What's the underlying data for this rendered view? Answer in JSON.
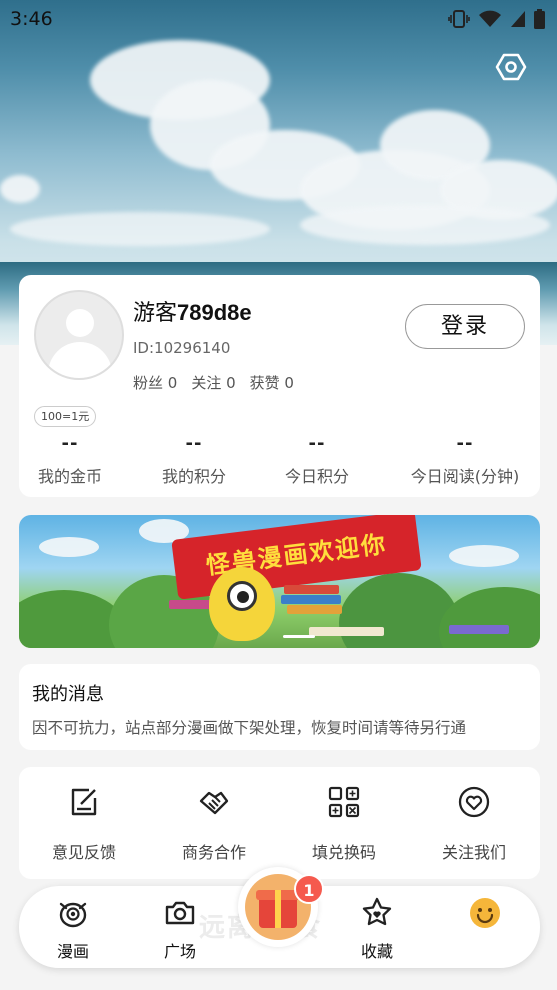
{
  "status_bar": {
    "time": "3:46"
  },
  "profile": {
    "username_prefix": "游客",
    "username_suffix": "789d8e",
    "user_id": "ID:10296140",
    "fans": "粉丝 0",
    "follows": "关注 0",
    "likes": "获赞 0",
    "login_label": "登录",
    "rate_badge": "100=1元"
  },
  "kpis": [
    {
      "value": "--",
      "label": "我的金币"
    },
    {
      "value": "--",
      "label": "我的积分"
    },
    {
      "value": "--",
      "label": "今日积分"
    },
    {
      "value": "--",
      "label": "今日阅读(分钟)"
    }
  ],
  "banner": {
    "flag_text": "怪兽漫画欢迎你"
  },
  "messages": {
    "title": "我的消息",
    "body": "因不可抗力，站点部分漫画做下架处理，恢复时间请等待另行通"
  },
  "quick_actions": [
    {
      "label": "意见反馈",
      "icon": "feedback-icon"
    },
    {
      "label": "商务合作",
      "icon": "handshake-icon"
    },
    {
      "label": "填兑换码",
      "icon": "redeem-code-icon"
    },
    {
      "label": "关注我们",
      "icon": "heart-icon"
    }
  ],
  "tabbar": {
    "watermark": "远离 追食",
    "tabs": [
      {
        "label": "漫画",
        "icon": "monster-icon"
      },
      {
        "label": "广场",
        "icon": "camera-icon"
      },
      {
        "label": "收藏",
        "icon": "star-heart-icon"
      },
      {
        "label": "",
        "icon": "smiley-icon"
      }
    ],
    "gift_badge_count": "1"
  },
  "colors": {
    "accent": "#f5b63a",
    "badge": "#f55a4e",
    "banner_flag": "#d6242a"
  }
}
